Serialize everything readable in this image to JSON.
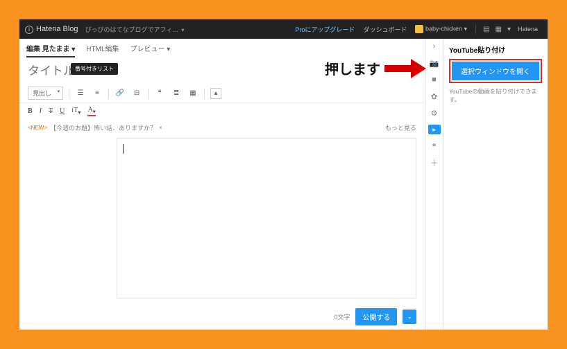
{
  "top": {
    "logo": "Hatena Blog",
    "blogname": "ぴっぴのはてなブログでアフィ…",
    "pro": "Proにアップグレード",
    "dashboard": "ダッシュボード",
    "user": "baby-chicken",
    "brand": "Hatena"
  },
  "tabs": {
    "edit": "編集 見たまま",
    "html": "HTML編集",
    "preview": "プレビュー"
  },
  "title_placeholder": "タイトル",
  "tooltip": "番号付きリスト",
  "heading_select": "見出し",
  "suggestion": {
    "new": "<NEW>",
    "text": "【今週のお題】怖い話、ありますか？",
    "more": "もっと見る"
  },
  "footer": {
    "count": "0文字",
    "publish": "公開する"
  },
  "side": {
    "title": "YouTube貼り付け",
    "button": "選択ウィンドウを開く",
    "desc": "YouTubeの動画を貼り付けできます。"
  },
  "annotation": "押します"
}
